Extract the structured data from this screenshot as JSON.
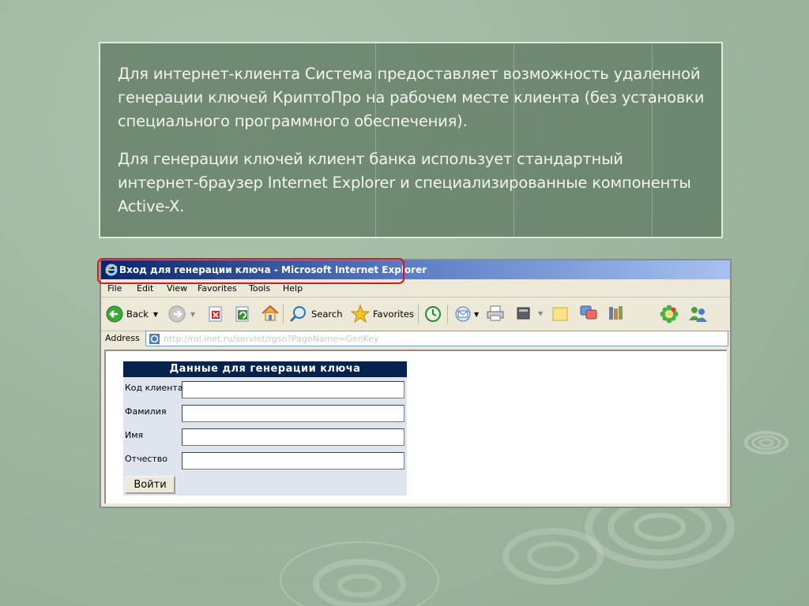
{
  "slide": {
    "paragraph1": "Для интернет-клиента Система предоставляет возможность удаленной генерации ключей КриптоПро на рабочем месте клиента (без установки специального программного обеспечения).",
    "paragraph2": "Для генерации ключей клиент банка использует стандартный интернет-браузер Internet Explorer и специализированные компоненты Active-X."
  },
  "browser": {
    "title": "Вход для генерации ключа - Microsoft Internet Explorer",
    "menu": [
      "File",
      "Edit",
      "View",
      "Favorites",
      "Tools",
      "Help"
    ],
    "toolbar": {
      "back_label": "Back",
      "search_label": "Search",
      "favorites_label": "Favorites"
    },
    "address": {
      "label": "Address",
      "url": "http://rol.inet.ru/servlet/rgso?PageName=GenKey"
    }
  },
  "form": {
    "title": "Данные для генерации ключа",
    "fields": [
      {
        "label": "Код клиента",
        "value": ""
      },
      {
        "label": "Фамилия",
        "value": ""
      },
      {
        "label": "Имя",
        "value": ""
      },
      {
        "label": "Отчество",
        "value": ""
      }
    ],
    "submit_label": "Войти"
  },
  "colors": {
    "highlight": "#e3141b",
    "form_header": "#06224f"
  }
}
